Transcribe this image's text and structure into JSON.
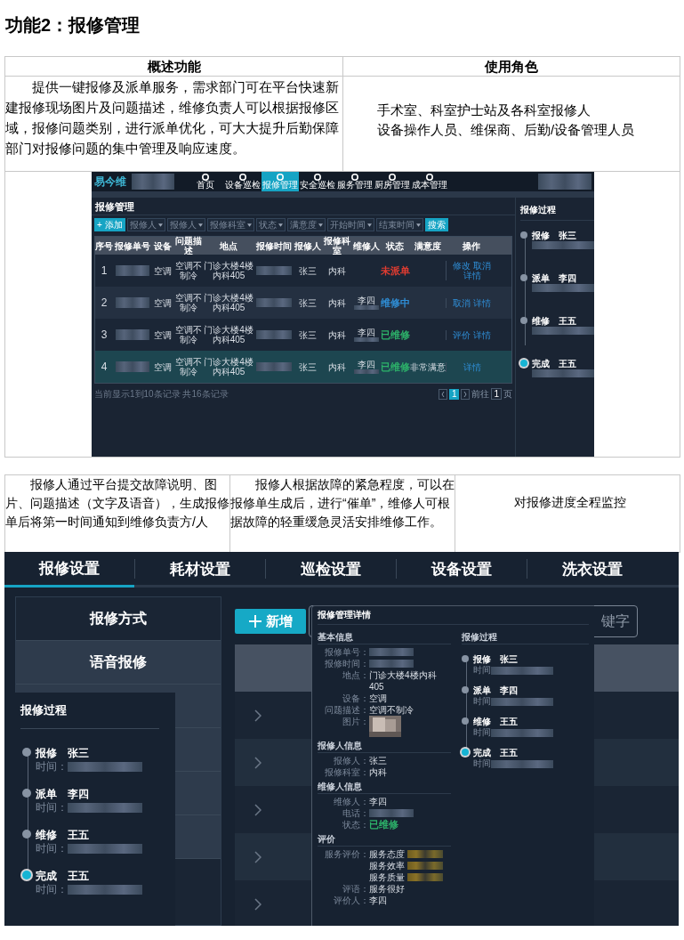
{
  "title": "功能2：报修管理",
  "overview": {
    "columns": [
      "概述功能",
      "使用角色"
    ],
    "description": "提供一键报修及派单服务，需求部门可在平台快速新建报修现场图片及问题描述，维修负责人可以根据报修区域，报修问题类别，进行派单优化，可大大提升后勤保障部门对报修问题的集中管理及响应速度。",
    "roles": [
      "手术室、科室护士站及各科室报修人",
      "设备操作人员、维保商、后勤/设备管理人员"
    ]
  },
  "app1": {
    "logo": "易今维",
    "nav": [
      {
        "label": "首页",
        "selected": false
      },
      {
        "label": "设备巡检",
        "selected": false
      },
      {
        "label": "报修管理",
        "selected": true
      },
      {
        "label": "安全巡检",
        "selected": false
      },
      {
        "label": "服务管理",
        "selected": false
      },
      {
        "label": "厨房管理",
        "selected": false
      },
      {
        "label": "成本管理",
        "selected": false
      }
    ],
    "page_title": "报修管理",
    "add_button": "+ 添加",
    "filters": [
      "报修人",
      "报修人",
      "报修科室",
      "状态",
      "满意度",
      "开始时间",
      "结束时间"
    ],
    "search_button": "搜索",
    "columns": [
      "序号",
      "报修单号",
      "设备",
      "问题描述",
      "地点",
      "报修时间",
      "报修人",
      "报修科室",
      "维修人",
      "状态",
      "满意度",
      "操作"
    ],
    "rows": [
      {
        "index": "1",
        "device": "空调",
        "problem": "空调不制冷",
        "location": "门诊大楼4楼内科405",
        "reporter": "张三",
        "department": "内科",
        "status": {
          "text": "未派单",
          "color": "#e03c31"
        },
        "actions": [
          "修改",
          "取消",
          "详情"
        ],
        "selected": false
      },
      {
        "index": "2",
        "device": "空调",
        "problem": "空调不制冷",
        "location": "门诊大楼4楼内科405",
        "reporter": "张三",
        "department": "内科",
        "repairer": "李四",
        "status": {
          "text": "维修中",
          "color": "#2f8fd8"
        },
        "actions": [
          "取消",
          "详情"
        ],
        "selected": false
      },
      {
        "index": "3",
        "device": "空调",
        "problem": "空调不制冷",
        "location": "门诊大楼4楼内科405",
        "reporter": "张三",
        "department": "内科",
        "repairer": "李四",
        "status": {
          "text": "已维修",
          "color": "#2db36a"
        },
        "actions": [
          "评价",
          "详情"
        ],
        "selected": false
      },
      {
        "index": "4",
        "device": "空调",
        "problem": "空调不制冷",
        "location": "门诊大楼4楼内科405",
        "reporter": "张三",
        "department": "内科",
        "repairer": "李四",
        "status": {
          "text": "已维修",
          "color": "#2db36a"
        },
        "satisfaction": "非常满意",
        "actions": [
          "详情"
        ],
        "selected": true
      }
    ],
    "footer": "当前显示1到10条记录 共16条记录",
    "pagination": {
      "page": "1",
      "goto_label": "前往",
      "goto_value": "1",
      "unit": "页"
    },
    "process": {
      "title": "报修过程",
      "steps": [
        {
          "action": "报修",
          "person": "张三",
          "current": false
        },
        {
          "action": "派单",
          "person": "李四",
          "current": false
        },
        {
          "action": "维修",
          "person": "王五",
          "current": false
        },
        {
          "action": "完成",
          "person": "王五",
          "current": true
        }
      ]
    }
  },
  "features": [
    "报修人通过平台提交故障说明、图片、问题描述（文字及语音），生成报修单后将第一时间通知到维修负责方/人",
    "报修人根据故障的紧急程度，可以在报修单生成后，进行“催单”，维修人可根据故障的轻重缓急灵活安排维修工作。",
    "对报修进度全程监控"
  ],
  "app2": {
    "tabs": [
      {
        "label": "报修设置",
        "selected": true
      },
      {
        "label": "耗材设置",
        "selected": false
      },
      {
        "label": "巡检设置",
        "selected": false
      },
      {
        "label": "设备设置",
        "selected": false
      },
      {
        "label": "洗衣设置",
        "selected": false
      }
    ],
    "sidebar": [
      {
        "label": "报修方式",
        "selected": false
      },
      {
        "label": "语音报修",
        "selected": true
      }
    ],
    "new_button": "新增",
    "search_placeholder": "键字",
    "process": {
      "title": "报修过程",
      "steps": [
        {
          "action": "报修",
          "person": "张三",
          "time_label": "时间：",
          "current": false
        },
        {
          "action": "派单",
          "person": "李四",
          "time_label": "时间：",
          "current": false
        },
        {
          "action": "维修",
          "person": "王五",
          "time_label": "时间：",
          "current": false
        },
        {
          "action": "完成",
          "person": "王五",
          "time_label": "时间：",
          "current": true
        }
      ]
    },
    "detail": {
      "title": "报修管理详情",
      "sections": [
        {
          "heading": "基本信息",
          "fields": [
            {
              "label": "报修单号：",
              "kind": "redacted"
            },
            {
              "label": "报修时间：",
              "kind": "redacted"
            },
            {
              "label": "地点：",
              "kind": "text",
              "value": "门诊大楼4楼内科405"
            },
            {
              "label": "设备：",
              "kind": "text",
              "value": "空调"
            },
            {
              "label": "问题描述：",
              "kind": "text",
              "value": "空调不制冷"
            },
            {
              "label": "图片：",
              "kind": "picture"
            }
          ]
        },
        {
          "heading": "报修人信息",
          "fields": [
            {
              "label": "报修人：",
              "kind": "text",
              "value": "张三"
            },
            {
              "label": "报修科室：",
              "kind": "text",
              "value": "内科"
            }
          ]
        },
        {
          "heading": "维修人信息",
          "fields": [
            {
              "label": "维修人：",
              "kind": "text",
              "value": "李四"
            },
            {
              "label": "电话：",
              "kind": "redacted"
            },
            {
              "label": "状态：",
              "kind": "status",
              "value": "已维修",
              "color": "#2db36a"
            }
          ]
        },
        {
          "heading": "评价",
          "fields": [
            {
              "label": "服务评价：",
              "kind": "ratings",
              "items": [
                "服务态度",
                "服务效率",
                "服务质量"
              ]
            },
            {
              "label": "评语：",
              "kind": "text",
              "value": "服务很好"
            },
            {
              "label": "评价人：",
              "kind": "text",
              "value": "李四"
            }
          ]
        }
      ],
      "process": {
        "title": "报修过程",
        "steps": [
          {
            "action": "报修",
            "person": "张三",
            "time_label": "时间",
            "current": false
          },
          {
            "action": "派单",
            "person": "李四",
            "time_label": "时间",
            "current": false
          },
          {
            "action": "维修",
            "person": "王五",
            "time_label": "时间",
            "current": false
          },
          {
            "action": "完成",
            "person": "王五",
            "time_label": "时间",
            "current": true
          }
        ]
      }
    }
  }
}
